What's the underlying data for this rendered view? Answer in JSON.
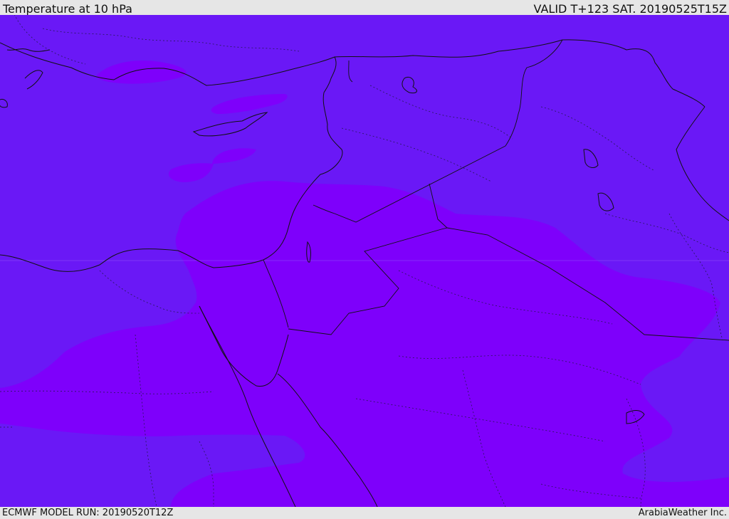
{
  "header": {
    "title": "Temperature at 10 hPa",
    "valid": "VALID T+123 SAT. 20190525T15Z"
  },
  "footer": {
    "model_run": "ECMWF MODEL RUN: 20190520T12Z",
    "credit": "ArabiaWeather Inc."
  },
  "colors": {
    "background_field": "#6a18f6",
    "warmer_field": "#7e00fb",
    "coastline": "#111111",
    "border_dotted": "#222244"
  }
}
